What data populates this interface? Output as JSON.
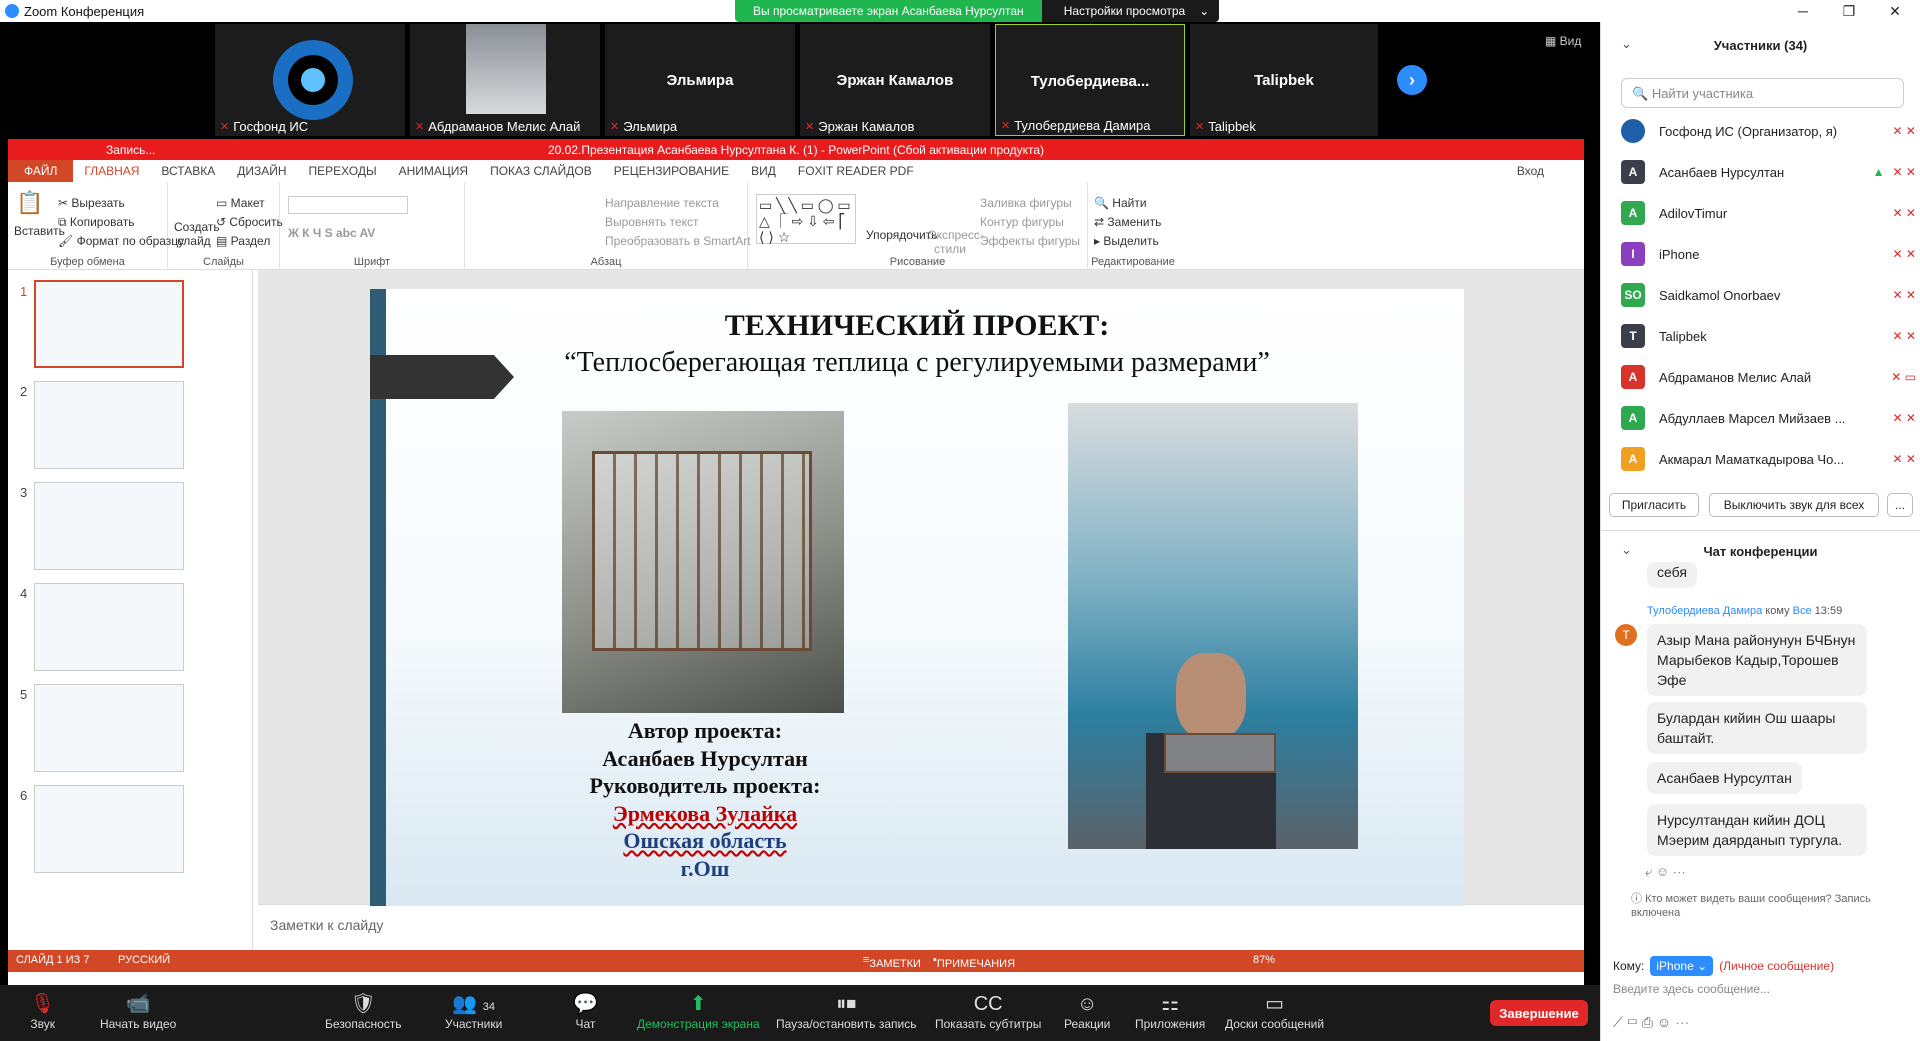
{
  "zoom": {
    "window_title": "Zoom Конференция",
    "share_banner": "Вы просматриваете экран Асанбаева Нурсултан",
    "view_settings": "Настройки просмотра",
    "view_label": "Вид",
    "video_tiles": [
      {
        "label": "Госфонд ИС"
      },
      {
        "label": "Абдраманов Мелис Алай"
      },
      {
        "name": "Эльмира",
        "label": "Эльмира"
      },
      {
        "name": "Эржан Камалов",
        "label": "Эржан Камалов"
      },
      {
        "name": "Тулобердиева...",
        "label": "Тулобердиева Дамира"
      },
      {
        "name": "Talipbek",
        "label": "Talipbek"
      }
    ]
  },
  "ppt": {
    "title": "20.02.Презентация Асанбаева Нурсултана К. (1) -  PowerPoint (Сбой активации продукта)",
    "recording": "Запись...",
    "login": "Вход",
    "tabs": [
      "ФАЙЛ",
      "ГЛАВНАЯ",
      "ВСТАВКА",
      "ДИЗАЙН",
      "ПЕРЕХОДЫ",
      "АНИМАЦИЯ",
      "ПОКАЗ СЛАЙДОВ",
      "РЕЦЕНЗИРОВАНИЕ",
      "ВИД",
      "FOXIT READER PDF"
    ],
    "ribbon": {
      "paste": "Вставить",
      "cut": "Вырезать",
      "copy": "Копировать",
      "format_painter": "Формат по образцу",
      "clipboard": "Буфер обмена",
      "new_slide": "Создать слайд",
      "layout": "Макет",
      "reset": "Сбросить",
      "section": "Раздел",
      "slides": "Слайды",
      "font": "Шрифт",
      "text_direction": "Направление текста",
      "align_text": "Выровнять текст",
      "smartart": "Преобразовать в SmartArt",
      "paragraph": "Абзац",
      "arrange": "Упорядочить",
      "quick_styles": "Экспресс-стили",
      "shape_fill": "Заливка фигуры",
      "shape_outline": "Контур фигуры",
      "shape_effects": "Эффекты фигуры",
      "drawing": "Рисование",
      "find": "Найти",
      "replace": "Заменить",
      "select": "Выделить",
      "editing": "Редактирование"
    },
    "thumb_numbers": [
      "1",
      "2",
      "3",
      "4",
      "5",
      "6"
    ],
    "slide": {
      "heading": "ТЕХНИЧЕСКИЙ ПРОЕКТ:",
      "subheading": "“Теплосберегающая теплица с регулируемыми размерами”",
      "author_label": "Автор проекта:",
      "author": "Асанбаев Нурсултан",
      "supervisor_label": "Руководитель проекта:",
      "supervisor": "Эрмекова Зулайка",
      "region": "Ошская область",
      "city": "г.Ош"
    },
    "notes_placeholder": "Заметки к слайду",
    "status": {
      "slide": "СЛАЙД 1 ИЗ 7",
      "lang": "РУССКИЙ",
      "notes": "ЗАМЕТКИ",
      "comments": "ПРИМЕЧАНИЯ",
      "zoom": "87%"
    }
  },
  "toolbar": {
    "audio": "Звук",
    "video": "Начать видео",
    "security": "Безопасность",
    "participants": "Участники",
    "participants_count": "34",
    "chat": "Чат",
    "share": "Демонстрация экрана",
    "pause_rec": "Пауза/остановить запись",
    "captions": "Показать субтитры",
    "reactions": "Реакции",
    "apps": "Приложения",
    "whiteboards": "Доски сообщений",
    "end": "Завершение"
  },
  "panel": {
    "participants_title": "Участники (34)",
    "search_placeholder": "Найти участника",
    "participants": [
      {
        "initial": "",
        "name": "Госфонд ИС (Организатор, я)",
        "color": "#1f5fa8"
      },
      {
        "initial": "А",
        "name": "Асанбаев Нурсултан",
        "color": "#3a3f4a"
      },
      {
        "initial": "A",
        "name": "AdilovTimur",
        "color": "#2fa84f"
      },
      {
        "initial": "I",
        "name": "iPhone",
        "color": "#8a3fbf"
      },
      {
        "initial": "SO",
        "name": "Saidkamol Onorbaev",
        "color": "#2fa84f"
      },
      {
        "initial": "T",
        "name": "Talipbek",
        "color": "#3a3f4a"
      },
      {
        "initial": "А",
        "name": "Абдраманов Мелис Алай",
        "color": "#d9342b"
      },
      {
        "initial": "А",
        "name": "Абдуллаев Марсел Мийзаев ...",
        "color": "#2fa84f"
      },
      {
        "initial": "А",
        "name": "Акмарал Маматкадырова Чо...",
        "color": "#f0a020"
      }
    ],
    "invite": "Пригласить",
    "mute_all": "Выключить звук для всех",
    "more": "...",
    "chat_title": "Чат конференции",
    "chat_prev": "себя",
    "sender": "Тулобердиева Дамира",
    "to_word": "кому",
    "to_all": "Все",
    "time": "13:59",
    "messages": [
      "Азыр Мана районунун БЧБнун Марыбеков Кадыр,Торошев Эфе",
      "Булардан кийин Ош шаары баштайт.",
      "Асанбаев Нурсултан",
      "Нурсултандан кийин ДОЦ Мэерим даярданып тургула."
    ],
    "who_can_see": "Кто может видеть ваши сообщения? Запись включена",
    "to_label": "Кому:",
    "to_value": "iPhone",
    "private": "(Личное сообщение)",
    "input_placeholder": "Введите здесь сообщение..."
  }
}
